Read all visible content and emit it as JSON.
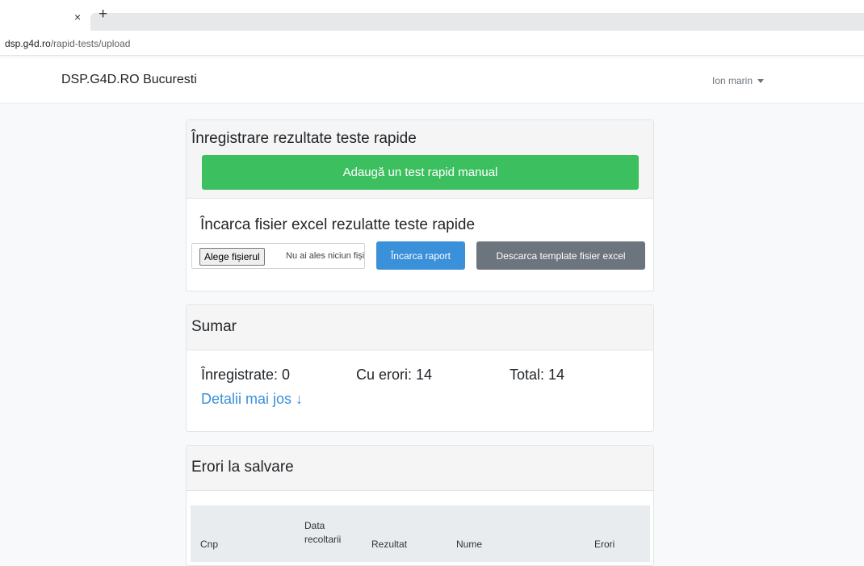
{
  "browser": {
    "close_tab": "×",
    "new_tab": "+",
    "url_host": "dsp.g4d.ro",
    "url_path": "/rapid-tests/upload"
  },
  "navbar": {
    "brand": "DSP.G4D.RO Bucuresti",
    "user": "Ion marin"
  },
  "upload_card": {
    "title": "Înregistrare rezultate teste rapide",
    "add_button": "Adaugă un test rapid manual",
    "excel_title": "Încarca fisier excel rezulatte teste rapide",
    "choose_file_button": "Alege fișierul",
    "file_status": "Nu ai ales niciun fișier",
    "upload_button": "Încarca raport",
    "template_button": "Descarca template fisier excel"
  },
  "summary_card": {
    "title": "Sumar",
    "registered": "Înregistrate: 0",
    "with_errors": "Cu erori: 14",
    "total": "Total: 14",
    "details_link": "Detalii mai jos ↓"
  },
  "errors_card": {
    "title": "Erori la salvare",
    "columns": {
      "cnp": "Cnp",
      "date_line1": "Data",
      "date_line2": "recoltarii",
      "result": "Rezultat",
      "name": "Nume",
      "errors": "Erori"
    }
  },
  "colors": {
    "success": "#3cbf5f",
    "primary": "#3a90d9",
    "secondary": "#6c757d"
  }
}
